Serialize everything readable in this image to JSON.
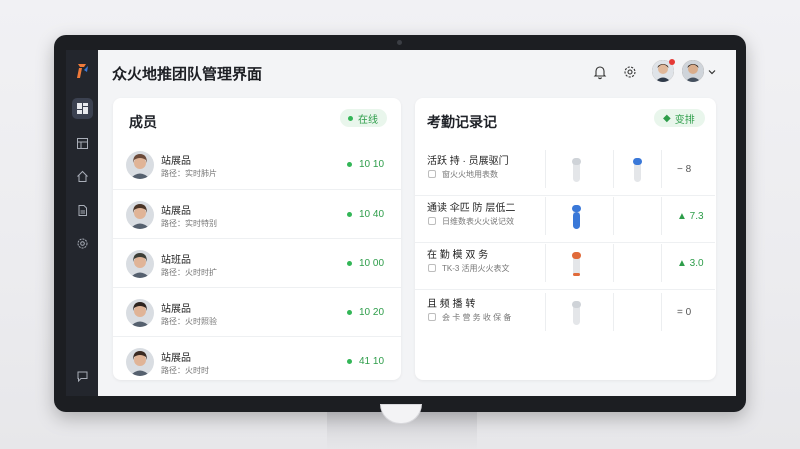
{
  "app": {
    "title": "众火地推团队管理界面"
  },
  "header": {
    "icons": [
      "bell-icon",
      "settings-icon",
      "user-avatar",
      "user-avatar",
      "chevron-down-icon"
    ]
  },
  "sidebar": {
    "logo": "app-logo",
    "items": [
      {
        "icon": "dashboard-icon",
        "active": true
      },
      {
        "icon": "layout-icon",
        "active": false
      },
      {
        "icon": "home-icon",
        "active": false
      },
      {
        "icon": "document-icon",
        "active": false
      },
      {
        "icon": "settings-icon",
        "active": false
      },
      {
        "icon": "chat-icon",
        "active": false
      }
    ]
  },
  "members_card": {
    "title": "成员",
    "status_label": "在线",
    "members": [
      {
        "name": "站展品",
        "sub": "路径：实时肺片",
        "value": "10 10",
        "avatar_color": "#6b4a3a"
      },
      {
        "name": "站展品",
        "sub": "路径：实时特别",
        "value": "10 40",
        "avatar_color": "#4a3426"
      },
      {
        "name": "站班品",
        "sub": "路径：火时时扩",
        "value": "10 00",
        "avatar_color": "#3d3f38"
      },
      {
        "name": "站展品",
        "sub": "路径：火时照验",
        "value": "10 20",
        "avatar_color": "#2d2420"
      },
      {
        "name": "站展品",
        "sub": "路径：火时时",
        "value": "41 10",
        "avatar_color": "#3a2a22"
      }
    ]
  },
  "attendance_card": {
    "title": "考勤记录记",
    "action_label": "变排",
    "records": [
      {
        "title": "活跃 持 · 员展驱门",
        "sub": "窗火火地用表数",
        "value": "− 8",
        "trend": "neutral",
        "level": 0.0,
        "level2": 0.0
      },
      {
        "title": "通读 伞匹 防 层低二",
        "sub": "日维数表火火说记效",
        "value": "▲ 7.3",
        "trend": "up",
        "level": 0.75
      },
      {
        "title": "在 勤 模 双 务",
        "sub": "TK-3 活用火火表文",
        "value": "▲ 3.0",
        "trend": "up",
        "level": 0.15
      },
      {
        "title": "且 频 播 转",
        "sub": "会 卡 营 务 收 保 备",
        "value": "= 0",
        "trend": "neutral",
        "level": 0.0
      }
    ]
  },
  "colors": {
    "accent_green": "#33b657",
    "gauge_blue": "#3a78d8",
    "gauge_orange": "#e06a3a",
    "sidebar_bg": "#23262d"
  }
}
